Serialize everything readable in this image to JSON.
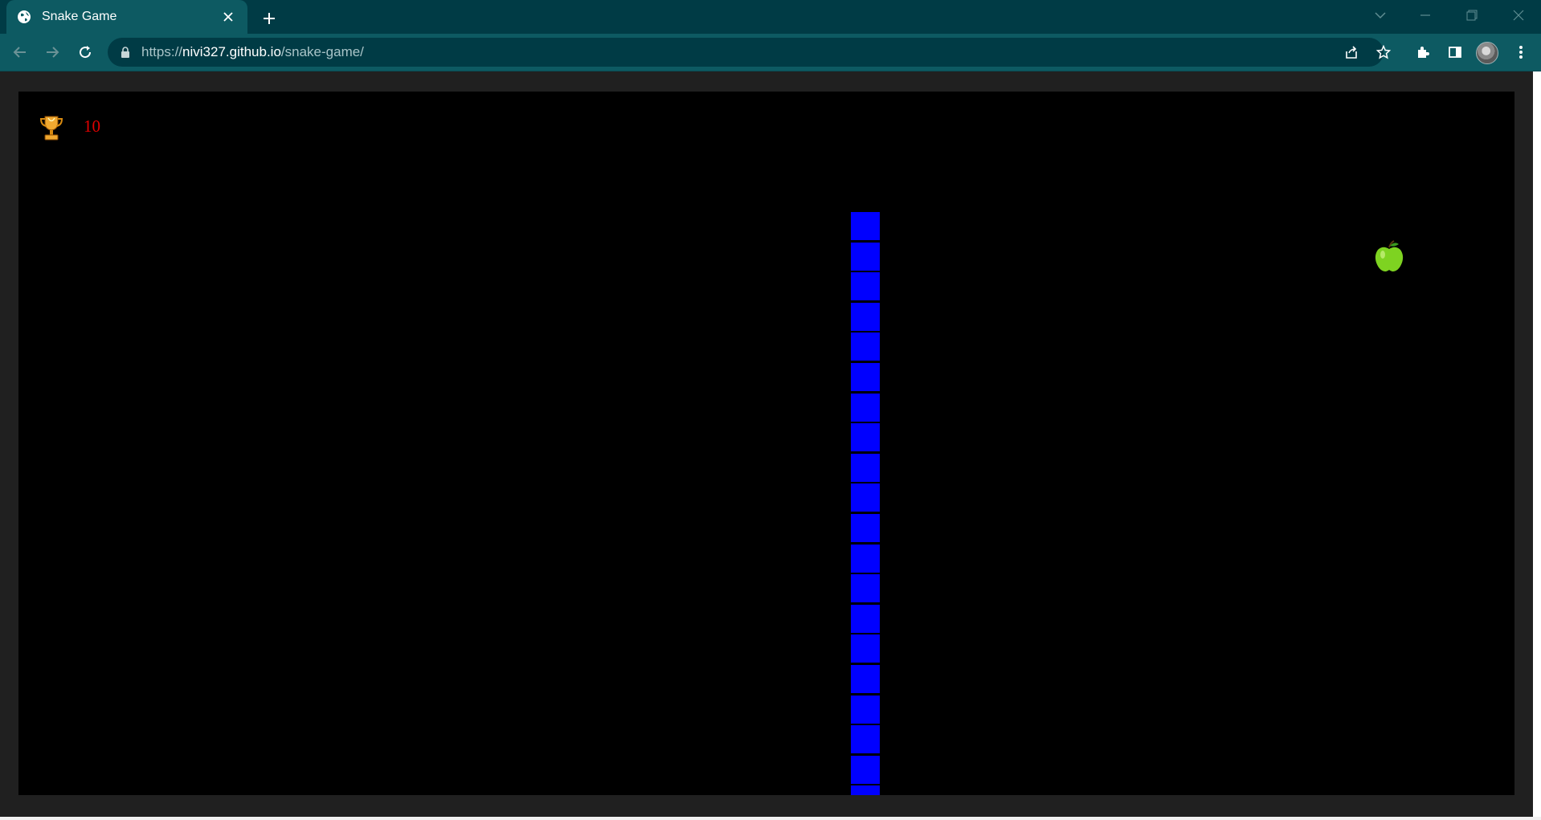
{
  "browser": {
    "tab_title": "Snake Game",
    "url_host": "nivi327.github.io",
    "url_prefix": "https://",
    "url_path": "/snake-game/"
  },
  "game": {
    "score": "10",
    "colors": {
      "board": "#000000",
      "snake": "#0000ff",
      "score_text": "#e00000",
      "apple": "#7ed321"
    },
    "snake_segment_count": 20
  }
}
